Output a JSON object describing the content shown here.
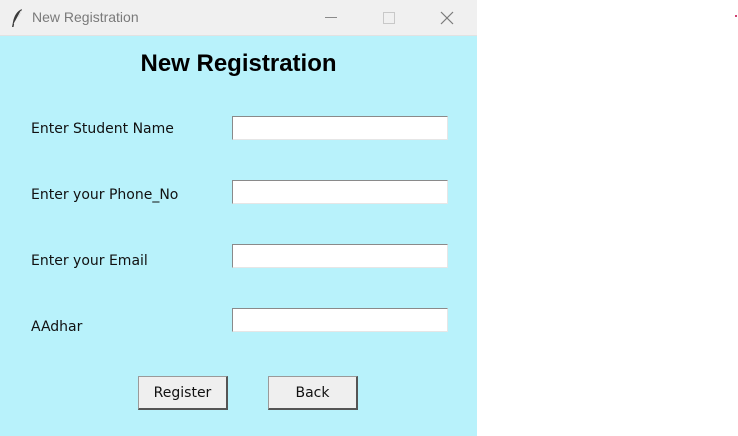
{
  "window": {
    "title": "New Registration",
    "accent_bg": "#b8f2fb"
  },
  "form": {
    "heading": "New Registration",
    "fields": [
      {
        "label": "Enter Student Name",
        "value": "",
        "placeholder": ""
      },
      {
        "label": "Enter your Phone_No",
        "value": "",
        "placeholder": ""
      },
      {
        "label": "Enter your Email",
        "value": "",
        "placeholder": ""
      },
      {
        "label": "AAdhar",
        "value": "",
        "placeholder": ""
      }
    ],
    "register_label": "Register",
    "back_label": "Back"
  }
}
